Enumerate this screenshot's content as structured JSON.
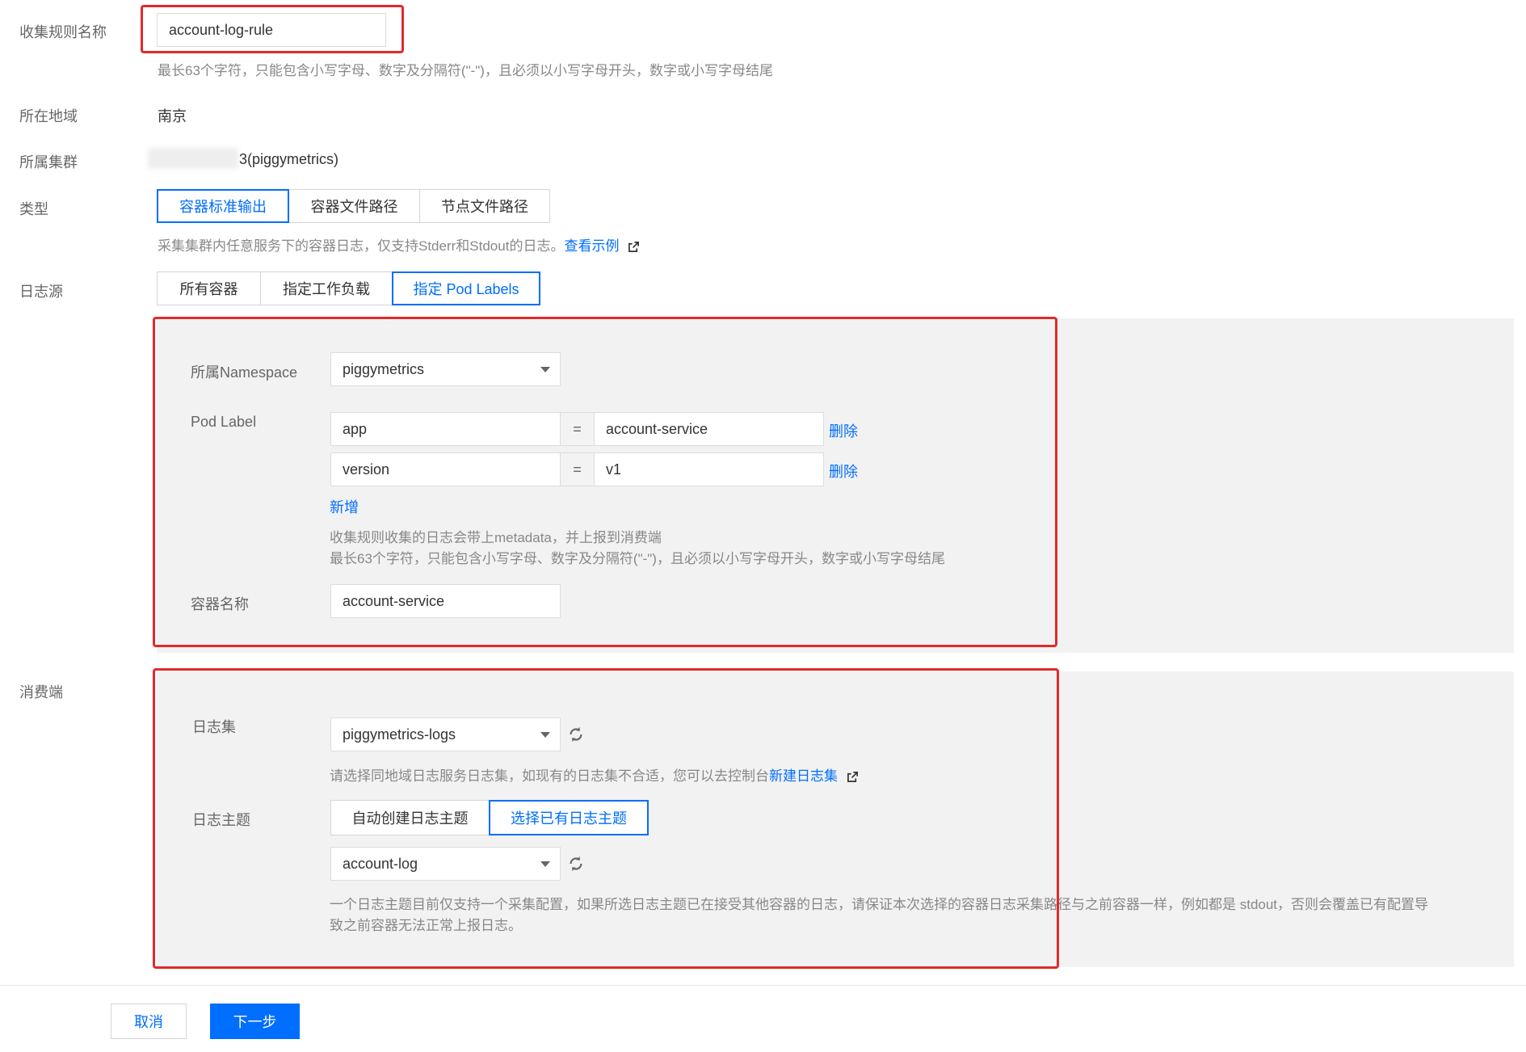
{
  "form": {
    "rule_name": {
      "label": "收集规则名称",
      "value": "account-log-rule",
      "help": "最长63个字符，只能包含小写字母、数字及分隔符(\"-\")，且必须以小写字母开头，数字或小写字母结尾"
    },
    "region": {
      "label": "所在地域",
      "value": "南京"
    },
    "cluster": {
      "label": "所属集群",
      "value": "3(piggymetrics)"
    },
    "type": {
      "label": "类型",
      "options": [
        "容器标准输出",
        "容器文件路径",
        "节点文件路径"
      ],
      "selected": "容器标准输出",
      "help": "采集集群内任意服务下的容器日志，仅支持Stderr和Stdout的日志。",
      "help_link": "查看示例"
    },
    "log_source": {
      "label": "日志源",
      "options": [
        "所有容器",
        "指定工作负载",
        "指定 Pod Labels"
      ],
      "selected": "指定 Pod Labels",
      "panel": {
        "namespace_label": "所属Namespace",
        "namespace_value": "piggymetrics",
        "pod_label_label": "Pod Label",
        "pod_labels": [
          {
            "key": "app",
            "eq": "=",
            "value": "account-service",
            "delete": "删除"
          },
          {
            "key": "version",
            "eq": "=",
            "value": "v1",
            "delete": "删除"
          }
        ],
        "add": "新增",
        "help1": "收集规则收集的日志会带上metadata，并上报到消费端",
        "help2": "最长63个字符，只能包含小写字母、数字及分隔符(\"-\")，且必须以小写字母开头，数字或小写字母结尾",
        "container_label": "容器名称",
        "container_value": "account-service"
      }
    },
    "consumer": {
      "label": "消费端",
      "panel": {
        "logset_label": "日志集",
        "logset_value": "piggymetrics-logs",
        "logset_help": "请选择同地域日志服务日志集，如现有的日志集不合适，您可以去控制台",
        "logset_help_link": "新建日志集",
        "topic_label": "日志主题",
        "topic_options": [
          "自动创建日志主题",
          "选择已有日志主题"
        ],
        "topic_selected": "选择已有日志主题",
        "topic_value": "account-log",
        "topic_help1": "一个日志主题目前仅支持一个采集配置，如果所选日志主题已在接受其他容器的日志，请保证本次选择的容器日志采集路径与之前容器一样，例如都是 stdout，否则会覆盖已有配置导",
        "topic_help2": "致之前容器无法正常上报日志。"
      }
    }
  },
  "footer": {
    "cancel": "取消",
    "next": "下一步"
  },
  "colors": {
    "accent": "#006eff",
    "highlight": "#e02a2a",
    "panel_bg": "#f2f2f2"
  },
  "icons": {
    "refresh": "refresh-icon",
    "external_link": "external-link-icon",
    "dropdown": "chevron-down-icon"
  }
}
